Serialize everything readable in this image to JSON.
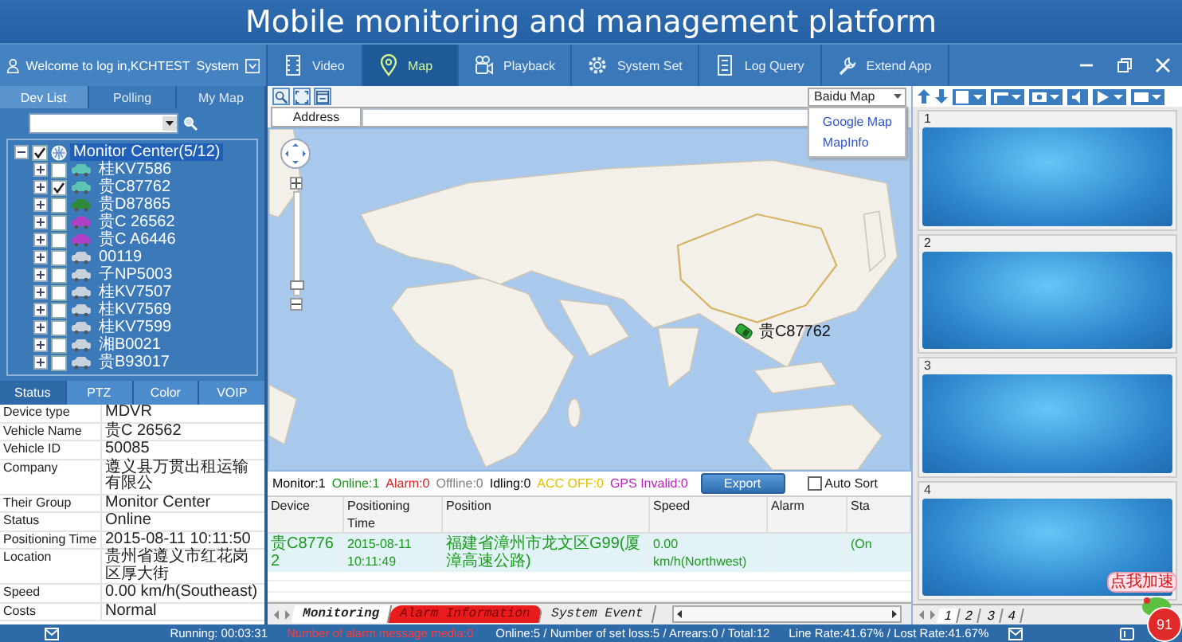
{
  "window": {
    "title": "Mobile monitoring and management platform"
  },
  "user_bar": {
    "welcome": "Welcome to log in,KCHTEST",
    "system": "System"
  },
  "nav_tabs": [
    {
      "label": "Video",
      "kind": "video",
      "selected": false
    },
    {
      "label": "Map",
      "kind": "map",
      "selected": true
    },
    {
      "label": "Playback",
      "kind": "playback",
      "selected": false
    },
    {
      "label": "System Set",
      "kind": "settings",
      "selected": false
    },
    {
      "label": "Log Query",
      "kind": "log",
      "selected": false
    },
    {
      "label": "Extend App",
      "kind": "extend",
      "selected": false
    }
  ],
  "left_tabs": [
    {
      "label": "Dev List",
      "selected": true
    },
    {
      "label": "Polling",
      "selected": false
    },
    {
      "label": "My Map",
      "selected": false
    }
  ],
  "tree": {
    "label": "Monitor Center(5/12)",
    "checked": true,
    "expanded": true,
    "selected": true,
    "children": [
      {
        "label": "桂KV7586",
        "checked": false,
        "expanded": false,
        "selected": false,
        "color": "#5cc4b4"
      },
      {
        "label": "贵C87762",
        "checked": true,
        "expanded": false,
        "selected": false,
        "color": "#5cc4b4"
      },
      {
        "label": "贵D87865",
        "checked": false,
        "expanded": false,
        "selected": false,
        "color": "#2e8b3a"
      },
      {
        "label": "贵C 26562",
        "checked": false,
        "expanded": false,
        "selected": false,
        "color": "#b040c8"
      },
      {
        "label": "贵C A6446",
        "checked": false,
        "expanded": false,
        "selected": false,
        "color": "#b040c8"
      },
      {
        "label": "00119",
        "checked": false,
        "expanded": false,
        "selected": false,
        "color": "#c8d2dc"
      },
      {
        "label": "子NP5003",
        "checked": false,
        "expanded": false,
        "selected": false,
        "color": "#c8d2dc"
      },
      {
        "label": "桂KV7507",
        "checked": false,
        "expanded": false,
        "selected": false,
        "color": "#c8d2dc"
      },
      {
        "label": "桂KV7569",
        "checked": false,
        "expanded": false,
        "selected": false,
        "color": "#c8d2dc"
      },
      {
        "label": "桂KV7599",
        "checked": false,
        "expanded": false,
        "selected": false,
        "color": "#c8d2dc"
      },
      {
        "label": "湘B0021",
        "checked": false,
        "expanded": false,
        "selected": false,
        "color": "#c8d2dc"
      },
      {
        "label": "贵B93017",
        "checked": false,
        "expanded": false,
        "selected": false,
        "color": "#c8d2dc"
      }
    ]
  },
  "info_tabs": [
    {
      "label": "Status",
      "selected": true
    },
    {
      "label": "PTZ",
      "selected": false
    },
    {
      "label": "Color",
      "selected": false
    },
    {
      "label": "VOIP",
      "selected": false
    }
  ],
  "info_rows": [
    {
      "field": "Device type",
      "value": "MDVR"
    },
    {
      "field": "Vehicle Name",
      "value": "贵C 26562"
    },
    {
      "field": "Vehicle ID",
      "value": "50085"
    },
    {
      "field": "Company",
      "value": "遵义县万贯出租运输有限公"
    },
    {
      "field": "Their Group",
      "value": "Monitor Center"
    },
    {
      "field": "Status",
      "value": "Online"
    },
    {
      "field": "Positioning Time",
      "value": "2015-08-11 10:11:50"
    },
    {
      "field": "Location",
      "value": "贵州省遵义市红花岗区厚大街"
    },
    {
      "field": "Speed",
      "value": "0.00 km/h(Southeast)"
    },
    {
      "field": "Costs",
      "value": "Normal"
    }
  ],
  "map": {
    "provider": "Baidu Map",
    "provider_options": [
      "Google Map",
      "MapInfo"
    ],
    "address_label": "Address",
    "zoom": {
      "level": 0.1
    },
    "marker_label": "贵C87762"
  },
  "summary": [
    {
      "text": "Monitor:1",
      "color": "#000000"
    },
    {
      "text": "Online:1",
      "color": "#1a9a1a"
    },
    {
      "text": "Alarm:0",
      "color": "#e02020"
    },
    {
      "text": "Offline:0",
      "color": "#808080"
    },
    {
      "text": "Idling:0",
      "color": "#000000"
    },
    {
      "text": "ACC OFF:0",
      "color": "#e0c000"
    },
    {
      "text": "GPS Invalid:0",
      "color": "#c020c0"
    }
  ],
  "export_button": "Export",
  "auto_sort": {
    "label": "Auto Sort",
    "checked": false
  },
  "table": {
    "columns": [
      "Device",
      "Positioning Time",
      "Position",
      "Speed",
      "Alarm",
      "Sta"
    ],
    "rows": [
      {
        "cells": [
          "贵C87762",
          "2015-08-11 10:11:49",
          "福建省漳州市龙文区G99(厦漳高速公路)",
          "0.00 km/h(Northwest)",
          "",
          "(On"
        ],
        "selected": true,
        "color": "#1a9a1a"
      }
    ]
  },
  "bottom_tabs": [
    {
      "label": "Monitoring",
      "kind": "normal",
      "selected": true
    },
    {
      "label": "Alarm Information",
      "kind": "alarm",
      "selected": false
    },
    {
      "label": "System Event",
      "kind": "normal",
      "selected": false
    }
  ],
  "video_panes": [
    "1",
    "2",
    "3",
    "4"
  ],
  "video_tabs": [
    {
      "label": "1",
      "selected": true
    },
    {
      "label": "2",
      "selected": false
    },
    {
      "label": "3",
      "selected": false
    },
    {
      "label": "4",
      "selected": false
    }
  ],
  "status_bar": {
    "running": "Running: 00:03:31",
    "alarm": "Number of alarm message media:0",
    "online": "Online:5 / Number of set loss:5 / Arrears:0 / Total:12",
    "rates": "Line Rate:41.67% / Lost Rate:41.67%"
  },
  "widget": {
    "bubble": "点我加速",
    "badge": "91"
  }
}
